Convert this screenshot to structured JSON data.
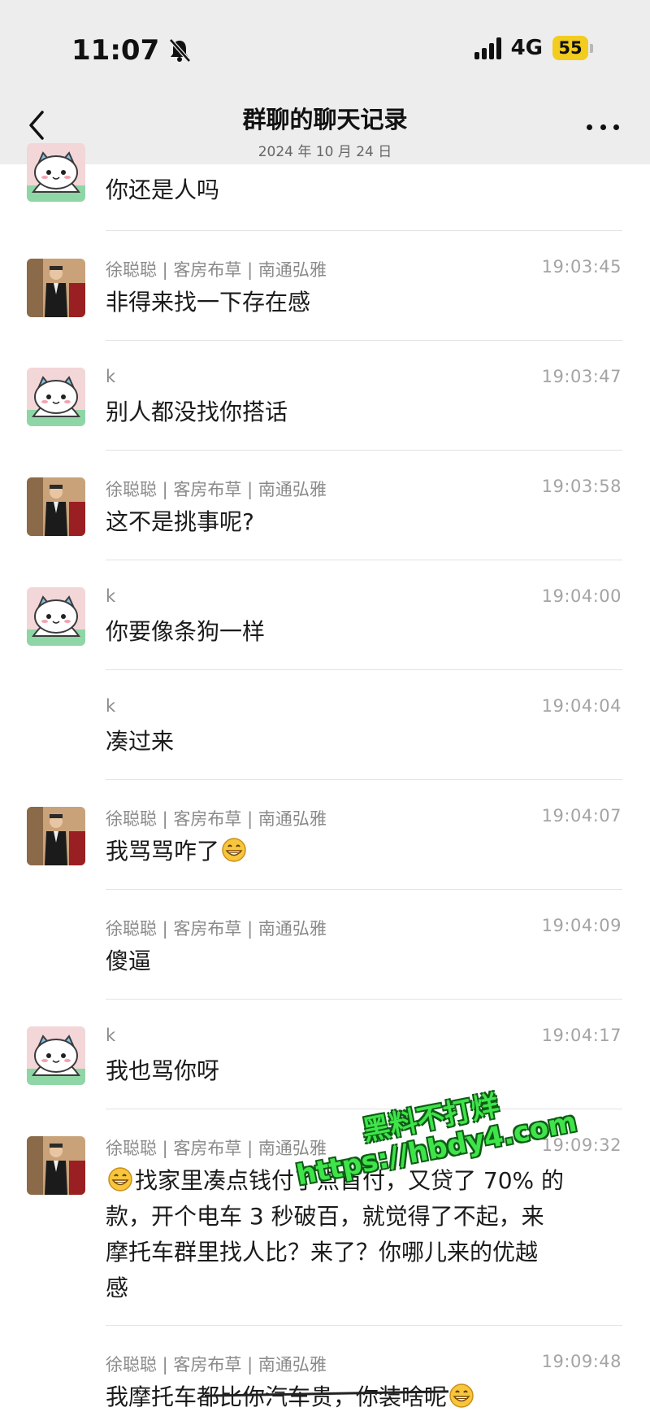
{
  "status_bar": {
    "time": "11:07",
    "network": "4G",
    "battery": "55"
  },
  "header": {
    "title": "群聊的聊天记录",
    "date": "2024 年 10 月 24 日"
  },
  "messages": [
    {
      "name": "",
      "time": "",
      "text": "你还是人吗",
      "avatar": "cat"
    },
    {
      "name": "徐聪聪 | 客房布草 | 南通弘雅",
      "time": "19:03:45",
      "text": "非得来找一下存在感",
      "avatar": "man"
    },
    {
      "name": "k",
      "time": "19:03:47",
      "text": "别人都没找你搭话",
      "avatar": "cat"
    },
    {
      "name": "徐聪聪 | 客房布草 | 南通弘雅",
      "time": "19:03:58",
      "text": "这不是挑事呢?",
      "avatar": "man"
    },
    {
      "name": "k",
      "time": "19:04:00",
      "text": "你要像条狗一样",
      "avatar": "cat"
    },
    {
      "name": "k",
      "time": "19:04:04",
      "text": "凑过来",
      "avatar": "none"
    },
    {
      "name": "徐聪聪 | 客房布草 | 南通弘雅",
      "time": "19:04:07",
      "text": "我骂骂咋了",
      "avatar": "man",
      "emoji_after": "grin-emoji"
    },
    {
      "name": "徐聪聪 | 客房布草 | 南通弘雅",
      "time": "19:04:09",
      "text": "傻逼",
      "avatar": "none"
    },
    {
      "name": "k",
      "time": "19:04:17",
      "text": "我也骂你呀",
      "avatar": "cat"
    },
    {
      "name": "徐聪聪 | 客房布草 | 南通弘雅",
      "time": "19:09:32",
      "avatar": "man",
      "lines": [
        "找家里凑点钱付了点首付，又贷了 70% 的",
        "款，开个电车 3 秒破百，就觉得了不起，来",
        "摩托车群里找人比？来了？你哪儿来的优越",
        "感"
      ],
      "emoji_before": "grin-emoji"
    },
    {
      "name": "徐聪聪 | 客房布草 | 南通弘雅",
      "time": "19:09:48",
      "text": "我摩托车都比你汽车贵，你装啥呢",
      "avatar": "none",
      "emoji_after": "grin-emoji"
    }
  ],
  "watermark": {
    "line1": "黑料不打烊",
    "line2": "https://hbdy4.com"
  },
  "colors": {
    "header_bg": "#ededed",
    "watermark": "#3fe34a",
    "battery": "#f2cc1e"
  }
}
